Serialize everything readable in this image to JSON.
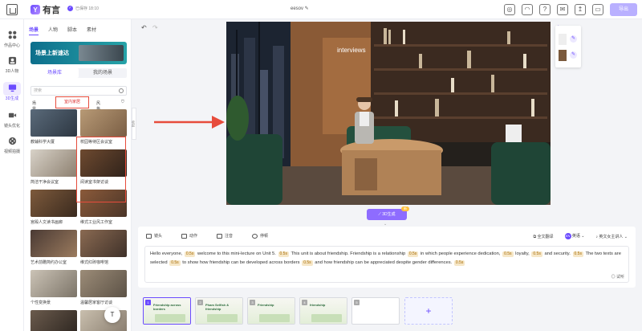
{
  "app": {
    "logo_text": "有言",
    "saved_text": "已保存 18:10",
    "doc_title": "eesov",
    "export_label": "导出"
  },
  "rail": {
    "items": [
      {
        "label": "作品中心",
        "icon": "grid-icon"
      },
      {
        "label": "3D人物",
        "icon": "person-icon"
      },
      {
        "label": "3D生成",
        "icon": "monitor-icon",
        "active": true
      },
      {
        "label": "镜头优化",
        "icon": "camera-icon"
      },
      {
        "label": "视频拍摄",
        "icon": "film-icon"
      }
    ]
  },
  "panel": {
    "tabs": [
      "场景",
      "人物",
      "脚本",
      "素材"
    ],
    "active_tab": "场景",
    "banner_text": "场景上新速达",
    "subtabs": [
      "场景库",
      "我的场景"
    ],
    "search_placeholder": "搜索",
    "filter_scene": "场景",
    "filter_indoor": "室内家居",
    "filter_style": "风格",
    "scenes": [
      {
        "caption": "教辅科学大厦",
        "color1": "#5a6a7a",
        "color2": "#2d3742"
      },
      {
        "caption": "校园等待区会议室",
        "color1": "#b89a76",
        "color2": "#7a5e44"
      },
      {
        "caption": "简洁干净会议室",
        "color1": "#d8d2c8",
        "color2": "#8c7f6f"
      },
      {
        "caption": "阅读室书架访谈",
        "color1": "#6e4a30",
        "color2": "#2f221a"
      },
      {
        "caption": "宫殿人文读书画廊",
        "color1": "#7d5a3c",
        "color2": "#3a2a1e"
      },
      {
        "caption": "维式工业风工作室",
        "color1": "#8b5a3a",
        "color2": "#4a3528"
      },
      {
        "caption": "艺术前瞻简约办公室",
        "color1": "#4a3a34",
        "color2": "#9b7b5e"
      },
      {
        "caption": "维式红砖咖啡馆",
        "color1": "#8a6a52",
        "color2": "#3f3129"
      },
      {
        "caption": "个性变换景",
        "color1": "#cbc3b6",
        "color2": "#7c7468"
      },
      {
        "caption": "温馨居家客厅访谈",
        "color1": "#9c8c78",
        "color2": "#5c5246"
      },
      {
        "caption": "",
        "color1": "#6b5b4d",
        "color2": "#2b241f"
      },
      {
        "caption": "",
        "color1": "#c9bfae",
        "color2": "#85796b"
      }
    ]
  },
  "preview": {
    "overlay_text": "interviews"
  },
  "generate": {
    "label": "3D生成",
    "badge": "新"
  },
  "editor": {
    "toolbar": [
      "镜头",
      "动作",
      "注音",
      "停顿"
    ],
    "right": {
      "translate": "全文翻译",
      "language": "英语",
      "language_badge": "EN",
      "voice": "英文女主讲人"
    },
    "script": [
      {
        "t": "Hello everyone, "
      },
      {
        "p": "0.5s"
      },
      {
        "t": " welcome to this mini-lecture on Unit 5. "
      },
      {
        "p": "0.5s"
      },
      {
        "t": " This unit is about friendship. Friendship is a relationship "
      },
      {
        "p": "0.5s"
      },
      {
        "t": " in which people experience dedication, "
      },
      {
        "p": "0.5s"
      },
      {
        "t": " loyalty, "
      },
      {
        "p": "0.5s"
      },
      {
        "t": " and security. "
      },
      {
        "p": "0.5s"
      },
      {
        "t": " The two texts are selected "
      },
      {
        "p": "0.5s"
      },
      {
        "t": " to show how friendship can be developed across borders "
      },
      {
        "p": "0.5s"
      },
      {
        "t": " and how friendship can be appreciated despite gender differences. "
      },
      {
        "p": "0.5s"
      }
    ],
    "listen_label": "试听"
  },
  "slides": [
    {
      "num": "1",
      "title": "Friendship across borders",
      "active": true
    },
    {
      "num": "2",
      "title": "Pham Selfish & friendship"
    },
    {
      "num": "3",
      "title": "Friendship"
    },
    {
      "num": "4",
      "title": "friendship"
    },
    {
      "num": "5",
      "title": ""
    }
  ],
  "upload_label": "T"
}
